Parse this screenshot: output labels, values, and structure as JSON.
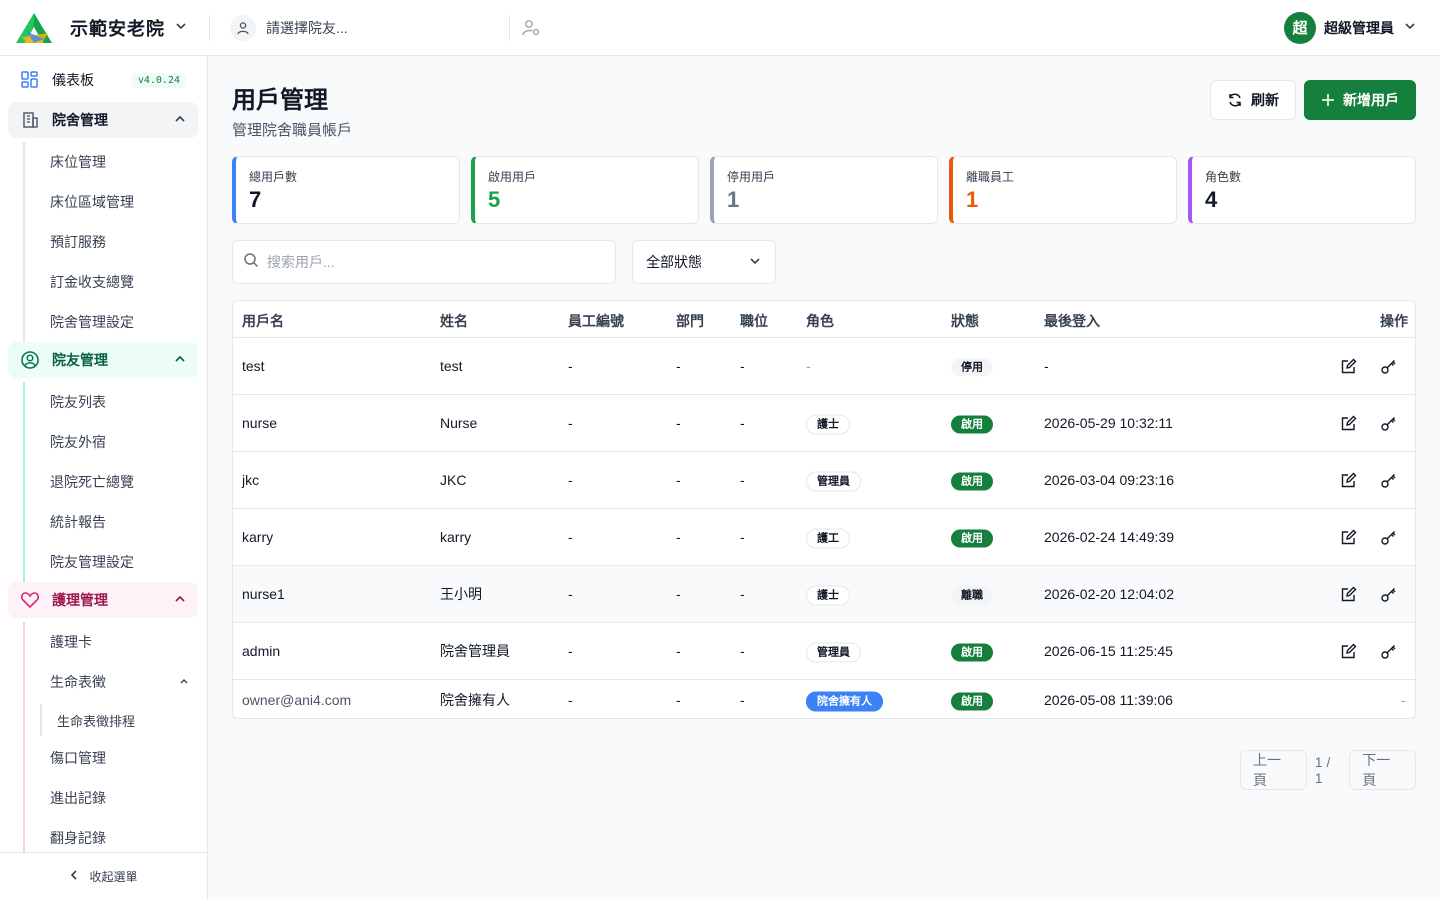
{
  "header": {
    "org_name": "示範安老院",
    "resident_placeholder": "請選擇院友...",
    "avatar_initial": "超",
    "user_name": "超級管理員"
  },
  "sidebar": {
    "version": "v4.0.24",
    "items": [
      {
        "label": "儀表板"
      },
      {
        "label": "院舍管理"
      },
      {
        "label": "院友管理"
      },
      {
        "label": "護理管理"
      }
    ],
    "facility_sub": [
      "床位管理",
      "床位區域管理",
      "預訂服務",
      "訂金收支總覽",
      "院舍管理設定"
    ],
    "resident_sub": [
      "院友列表",
      "院友外宿",
      "退院死亡總覽",
      "統計報告",
      "院友管理設定"
    ],
    "care_sub": [
      "護理卡",
      "生命表徵",
      "傷口管理",
      "進出記錄",
      "翻身記錄"
    ],
    "vitals_sub": [
      "生命表徵排程"
    ],
    "collapse_label": "收起選單"
  },
  "page": {
    "title": "用戶管理",
    "subtitle": "管理院舍職員帳戶",
    "refresh_label": "刷新",
    "add_label": "新增用戶"
  },
  "stats": [
    {
      "label": "總用戶數",
      "value": "7",
      "color": "#3b82f6"
    },
    {
      "label": "啟用用戶",
      "value": "5",
      "color": "#16a34a"
    },
    {
      "label": "停用用戶",
      "value": "1",
      "color": "#9ca3af"
    },
    {
      "label": "離職員工",
      "value": "1",
      "color": "#ea580c"
    },
    {
      "label": "角色數",
      "value": "4",
      "color": "#a855f7"
    }
  ],
  "filters": {
    "search_placeholder": "搜索用戶...",
    "status_value": "全部狀態"
  },
  "table": {
    "headers": [
      "用戶名",
      "姓名",
      "員工編號",
      "部門",
      "職位",
      "角色",
      "狀態",
      "最後登入",
      "操作"
    ],
    "rows": [
      {
        "username": "test",
        "name": "test",
        "staff_no": "-",
        "dept": "-",
        "position": "-",
        "role": "-",
        "status": "停用",
        "last_login": "-"
      },
      {
        "username": "nurse",
        "name": "Nurse",
        "staff_no": "-",
        "dept": "-",
        "position": "-",
        "role": "護士",
        "status": "啟用",
        "last_login": "2026-05-29 10:32:11"
      },
      {
        "username": "jkc",
        "name": "JKC",
        "staff_no": "-",
        "dept": "-",
        "position": "-",
        "role": "管理員",
        "status": "啟用",
        "last_login": "2026-03-04 09:23:16"
      },
      {
        "username": "karry",
        "name": "karry",
        "staff_no": "-",
        "dept": "-",
        "position": "-",
        "role": "護工",
        "status": "啟用",
        "last_login": "2026-02-24 14:49:39"
      },
      {
        "username": "nurse1",
        "name": "王小明",
        "staff_no": "-",
        "dept": "-",
        "position": "-",
        "role": "護士",
        "status": "離職",
        "last_login": "2026-02-20 12:04:02"
      },
      {
        "username": "admin",
        "name": "院舍管理員",
        "staff_no": "-",
        "dept": "-",
        "position": "-",
        "role": "管理員",
        "status": "啟用",
        "last_login": "2026-06-15 11:25:45"
      },
      {
        "username": "owner@ani4.com",
        "name": "院舍擁有人",
        "staff_no": "-",
        "dept": "-",
        "position": "-",
        "role": "院舍擁有人",
        "status": "啟用",
        "last_login": "2026-05-08 11:39:06",
        "action": "-"
      }
    ]
  },
  "pagination": {
    "prev_label": "上一頁",
    "page_info": "1 / 1",
    "next_label": "下一頁"
  }
}
